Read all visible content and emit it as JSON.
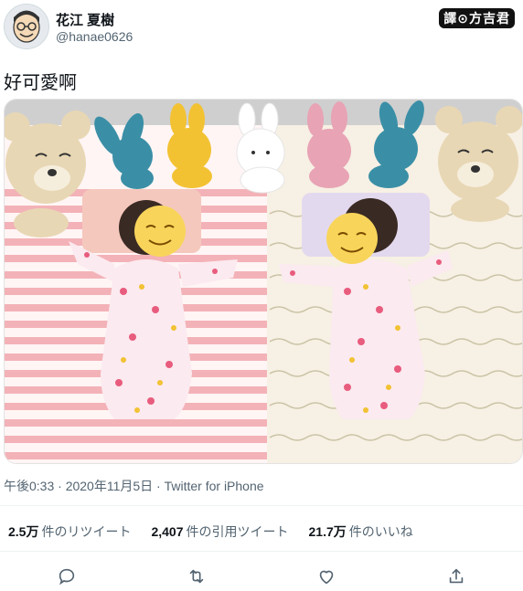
{
  "user": {
    "display_name": "花江 夏樹",
    "handle": "@hanae0626",
    "avatar_icon": "user-avatar"
  },
  "watermark": "譯⊙方吉君",
  "tweet": {
    "text": "好可愛啊",
    "meta": "午後0:33 · 2020年11月5日 · Twitter for iPhone"
  },
  "stats": {
    "retweets_count": "2.5万",
    "retweets_label": "件のリツイート",
    "quotes_count": "2,407",
    "quotes_label": "件の引用ツイート",
    "likes_count": "21.7万",
    "likes_label": "件のいいね"
  },
  "actions": [
    "reply-icon",
    "retweet-icon",
    "like-icon",
    "share-icon"
  ],
  "colors": {
    "pink_stripe": "#f3b2b7",
    "cream_blanket": "#f7f0e4",
    "bear": "#e8d7b4",
    "teal": "#3a8fa6",
    "yellow": "#f2c233",
    "pink": "#e8a3b5",
    "emoji": "#f8d55a"
  }
}
